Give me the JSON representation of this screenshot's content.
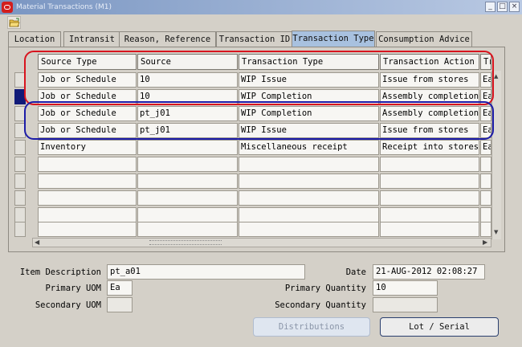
{
  "window": {
    "title": "Material Transactions (M1)",
    "minimize": "_",
    "maximize": "□",
    "close": "×"
  },
  "tabs": [
    {
      "label": "Location"
    },
    {
      "label": "Intransit"
    },
    {
      "label": "Reason, Reference"
    },
    {
      "label": "Transaction ID"
    },
    {
      "label": "Transaction Type",
      "active": true
    },
    {
      "label": "Consumption Advice"
    }
  ],
  "grid": {
    "columns": [
      "Source Type",
      "Source",
      "Transaction Type",
      "Transaction Action",
      "Tr"
    ],
    "rows": [
      [
        "Job or Schedule",
        "10",
        "WIP Issue",
        "Issue from stores",
        "Ea"
      ],
      [
        "Job or Schedule",
        "10",
        "WIP Completion",
        "Assembly completion",
        "Ea"
      ],
      [
        "Job or Schedule",
        "pt_j01",
        "WIP Completion",
        "Assembly completion",
        "Ea"
      ],
      [
        "Job or Schedule",
        "pt_j01",
        "WIP Issue",
        "Issue from stores",
        "Ea"
      ],
      [
        "Inventory",
        "",
        "Miscellaneous receipt",
        "Receipt into stores",
        "Ea"
      ],
      [
        "",
        "",
        "",
        "",
        ""
      ],
      [
        "",
        "",
        "",
        "",
        ""
      ],
      [
        "",
        "",
        "",
        "",
        ""
      ],
      [
        "",
        "",
        "",
        "",
        ""
      ],
      [
        "",
        "",
        "",
        "",
        ""
      ]
    ],
    "current_row": 1
  },
  "details": {
    "item_description_label": "Item Description",
    "item_description_value": "pt_a01",
    "date_label": "Date",
    "date_value": "21-AUG-2012 02:08:27",
    "primary_uom_label": "Primary UOM",
    "primary_uom_value": "Ea",
    "primary_quantity_label": "Primary Quantity",
    "primary_quantity_value": "10",
    "secondary_uom_label": "Secondary UOM",
    "secondary_uom_value": "",
    "secondary_quantity_label": "Secondary Quantity",
    "secondary_quantity_value": ""
  },
  "buttons": {
    "distributions_label": "Distributions",
    "lot_serial_label": "Lot / Serial"
  },
  "colors": {
    "active_tab": "#a8c1df",
    "current_row_marker": "#101a78",
    "annotation_red": "#d8141e",
    "annotation_blue": "#1c1ca8"
  }
}
